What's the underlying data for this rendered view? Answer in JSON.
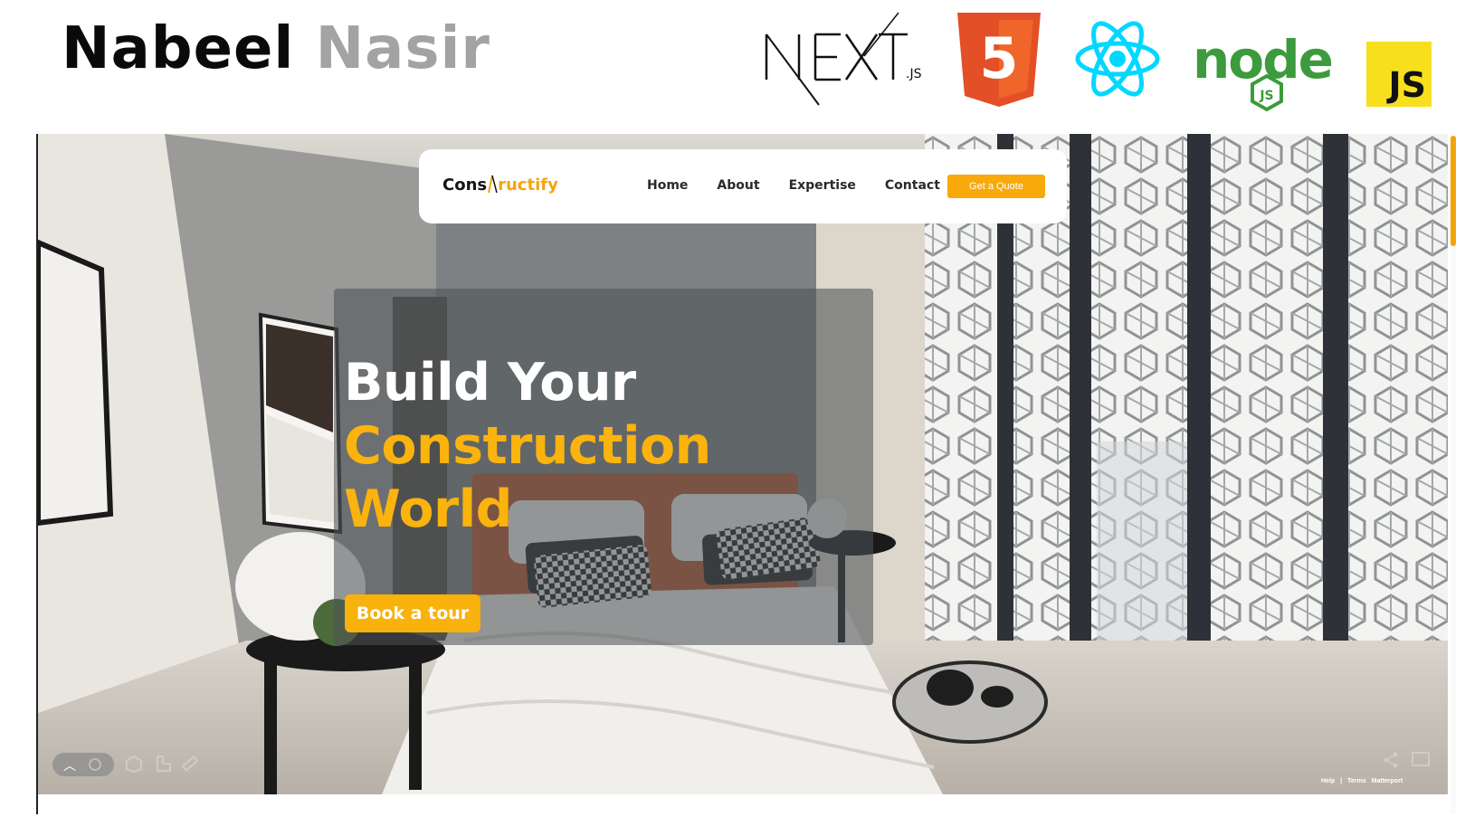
{
  "header": {
    "name_first": "Nabeel",
    "name_last": "Nasir",
    "logos": [
      {
        "icon": "nextjs-logo",
        "text": "NEXT",
        "suffix": ".JS"
      },
      {
        "icon": "html5-logo",
        "text": "5"
      },
      {
        "icon": "react-logo"
      },
      {
        "icon": "nodejs-logo",
        "text": "node",
        "badge": "JS"
      },
      {
        "icon": "javascript-logo",
        "text": "JS"
      }
    ]
  },
  "site": {
    "brand_part1": "Cons",
    "brand_part2": "ructify",
    "nav": [
      "Home",
      "About",
      "Expertise",
      "Contact"
    ],
    "cta_label": "Get a Quote",
    "hero_line1": "Build Your",
    "hero_line2": "Construction",
    "hero_line3": "World",
    "hero_button": "Book a tour",
    "footer_links": [
      "Help",
      "|",
      "Terms",
      "Matterport"
    ]
  },
  "colors": {
    "accent": "#F8A90B",
    "nav_bg": "#FFFFFF",
    "name_primary": "#0A0A0A",
    "name_secondary": "#A3A3A3"
  }
}
